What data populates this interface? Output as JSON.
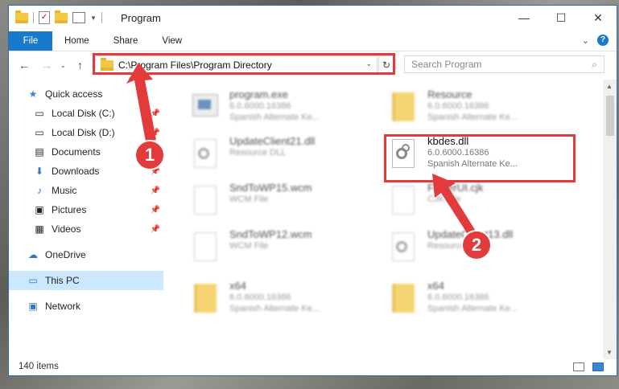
{
  "window": {
    "title": "Program"
  },
  "ribbon": {
    "tabs": [
      "File",
      "Home",
      "Share",
      "View"
    ],
    "help_label": "?"
  },
  "address": {
    "path": "C:\\Program Files\\Program Directory"
  },
  "search": {
    "placeholder": "Search Program"
  },
  "sidebar": {
    "items": [
      {
        "label": "Quick access",
        "icon": "star-icon"
      },
      {
        "label": "Local Disk (C:)",
        "icon": "drive-icon"
      },
      {
        "label": "Local Disk (D:)",
        "icon": "drive-icon"
      },
      {
        "label": "Documents",
        "icon": "documents-icon"
      },
      {
        "label": "Downloads",
        "icon": "downloads-icon"
      },
      {
        "label": "Music",
        "icon": "music-icon"
      },
      {
        "label": "Pictures",
        "icon": "pictures-icon"
      },
      {
        "label": "Videos",
        "icon": "videos-icon"
      },
      {
        "label": "OneDrive",
        "icon": "cloud-icon"
      },
      {
        "label": "This PC",
        "icon": "computer-icon"
      },
      {
        "label": "Network",
        "icon": "network-icon"
      }
    ]
  },
  "files": [
    {
      "name": "program.exe",
      "line1": "6.0.6000.16386",
      "line2": "Spanish Alternate Ke...",
      "icon": "exe-icon"
    },
    {
      "name": "Resource",
      "line1": "6.0.6000.16386",
      "line2": "Spanish Alternate Ke...",
      "icon": "folder-icon"
    },
    {
      "name": "UpdateClient21.dll",
      "line1": "Resource DLL",
      "line2": "",
      "icon": "dll-icon"
    },
    {
      "name": "kbdes.dll",
      "line1": "6.0.6000.16386",
      "line2": "Spanish Alternate Ke...",
      "icon": "dll-icon"
    },
    {
      "name": "SndToWP15.wcm",
      "line1": "WCM File",
      "line2": "",
      "icon": "file-icon"
    },
    {
      "name": "FolderUI.cjk",
      "line1": "CJK File",
      "line2": "",
      "icon": "file-icon"
    },
    {
      "name": "SndToWP12.wcm",
      "line1": "WCM File",
      "line2": "",
      "icon": "file-icon"
    },
    {
      "name": "UpdateClient13.dll",
      "line1": "Resource DLL",
      "line2": "",
      "icon": "dll-icon"
    },
    {
      "name": "x64",
      "line1": "6.0.6000.16386",
      "line2": "Spanish Alternate Ke...",
      "icon": "folder-icon"
    },
    {
      "name": "x64",
      "line1": "6.0.6000.16386",
      "line2": "Spanish Alternate Ke...",
      "icon": "folder-icon"
    }
  ],
  "status": {
    "items_count": "140 items"
  },
  "annotations": {
    "step1": "1",
    "step2": "2",
    "accent": "#e23b3b"
  }
}
